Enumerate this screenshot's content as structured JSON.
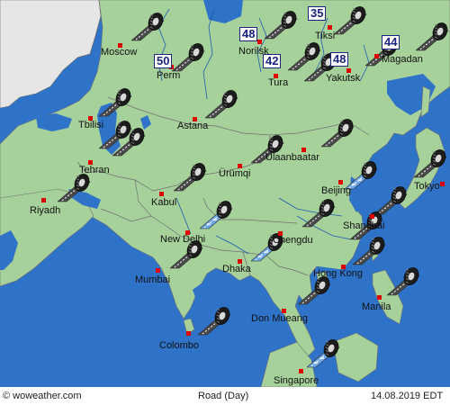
{
  "footer": {
    "credit": "© woweather.com",
    "title": "Road (Day)",
    "date": "14.08.2019 EDT"
  },
  "colors": {
    "water": "#2f73c8",
    "land": "#a6d19b",
    "other_land": "#e6e6e6",
    "borders": "#707070",
    "rivers": "#1e5bb0",
    "city_dot": "#e00000",
    "speed_badge_text": "#1a237e"
  },
  "cities": [
    {
      "id": "moscow",
      "name": "Moscow"
    },
    {
      "id": "perm",
      "name": "Perm"
    },
    {
      "id": "norilsk",
      "name": "Norilsk"
    },
    {
      "id": "tiksi",
      "name": "Tiksi"
    },
    {
      "id": "magadan",
      "name": "Magadan"
    },
    {
      "id": "tura",
      "name": "Tura"
    },
    {
      "id": "yakutsk",
      "name": "Yakutsk"
    },
    {
      "id": "tbilisi",
      "name": "Tbilisi"
    },
    {
      "id": "astana",
      "name": "Astana"
    },
    {
      "id": "tehran",
      "name": "Tehran"
    },
    {
      "id": "ulaanbaatar",
      "name": "Ulaanbaatar"
    },
    {
      "id": "urumqi",
      "name": "Ürümqi"
    },
    {
      "id": "riyadh",
      "name": "Riyadh"
    },
    {
      "id": "kabul",
      "name": "Kabul"
    },
    {
      "id": "beijing",
      "name": "Beijing"
    },
    {
      "id": "tokyo",
      "name": "Tokyo"
    },
    {
      "id": "new-delhi",
      "name": "New Delhi"
    },
    {
      "id": "chengdu",
      "name": "Chengdu"
    },
    {
      "id": "shanghai",
      "name": "Shanghai"
    },
    {
      "id": "mumbai",
      "name": "Mumbai"
    },
    {
      "id": "dhaka",
      "name": "Dhaka"
    },
    {
      "id": "hong-kong",
      "name": "Hong Kong"
    },
    {
      "id": "manila",
      "name": "Manila"
    },
    {
      "id": "don-mueang",
      "name": "Don Mueang"
    },
    {
      "id": "colombo",
      "name": "Colombo"
    },
    {
      "id": "singapore",
      "name": "Singapore"
    }
  ],
  "speed_badges": [
    {
      "id": "perm",
      "value": "50"
    },
    {
      "id": "norilsk",
      "value": "48"
    },
    {
      "id": "tura",
      "value": "42"
    },
    {
      "id": "tiksi",
      "value": "35"
    },
    {
      "id": "magadan",
      "value": "44"
    },
    {
      "id": "yakutsk",
      "value": "48"
    }
  ],
  "road_conditions": [
    {
      "id": "moscow",
      "condition": "dry",
      "icon": "tire-road-icon"
    },
    {
      "id": "norilsk",
      "condition": "dry",
      "icon": "tire-road-icon"
    },
    {
      "id": "tiksi",
      "condition": "dry",
      "icon": "tire-road-icon"
    },
    {
      "id": "far-east",
      "condition": "dry",
      "icon": "tire-road-icon"
    },
    {
      "id": "magadan",
      "condition": "dry",
      "icon": "tire-road-icon"
    },
    {
      "id": "perm",
      "condition": "dry",
      "icon": "tire-road-icon"
    },
    {
      "id": "tura",
      "condition": "dry",
      "icon": "tire-road-icon"
    },
    {
      "id": "yakutsk",
      "condition": "dry",
      "icon": "tire-road-icon"
    },
    {
      "id": "caspian",
      "condition": "dry",
      "icon": "tire-road-icon"
    },
    {
      "id": "astana",
      "condition": "dry",
      "icon": "tire-road-icon"
    },
    {
      "id": "tbilisi",
      "condition": "dry",
      "icon": "tire-road-icon"
    },
    {
      "id": "ulaanbaatar",
      "condition": "dry",
      "icon": "tire-road-icon"
    },
    {
      "id": "mongolia-east",
      "condition": "dry",
      "icon": "tire-road-icon"
    },
    {
      "id": "tehran",
      "condition": "dry",
      "icon": "tire-road-icon"
    },
    {
      "id": "urumqi",
      "condition": "dry",
      "icon": "tire-road-icon"
    },
    {
      "id": "riyadh",
      "condition": "dry",
      "icon": "tire-road-icon"
    },
    {
      "id": "beijing",
      "condition": "wet",
      "icon": "tire-road-icon"
    },
    {
      "id": "japan",
      "condition": "dry",
      "icon": "tire-road-icon"
    },
    {
      "id": "tokyo",
      "condition": "dry",
      "icon": "tire-road-icon"
    },
    {
      "id": "tibet",
      "condition": "wet",
      "icon": "tire-road-icon"
    },
    {
      "id": "china-central",
      "condition": "dry",
      "icon": "tire-road-icon"
    },
    {
      "id": "shanghai",
      "condition": "dry",
      "icon": "tire-road-icon"
    },
    {
      "id": "new-delhi",
      "condition": "dry",
      "icon": "tire-road-icon"
    },
    {
      "id": "chengdu",
      "condition": "wet",
      "icon": "tire-road-icon"
    },
    {
      "id": "hong-kong",
      "condition": "dry",
      "icon": "tire-road-icon"
    },
    {
      "id": "manila",
      "condition": "dry",
      "icon": "tire-road-icon"
    },
    {
      "id": "bay-of-bengal",
      "condition": "dry",
      "icon": "tire-road-icon"
    },
    {
      "id": "don-mueang",
      "condition": "dry",
      "icon": "tire-road-icon"
    },
    {
      "id": "singapore",
      "condition": "wet",
      "icon": "tire-road-icon"
    }
  ]
}
